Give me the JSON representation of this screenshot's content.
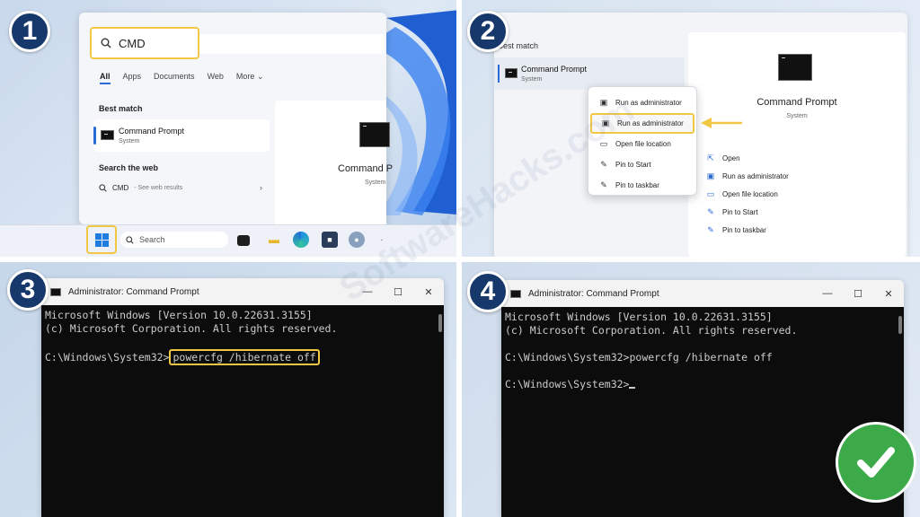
{
  "steps": [
    "1",
    "2",
    "3",
    "4"
  ],
  "step1": {
    "search_value": "CMD",
    "filters": [
      "All",
      "Apps",
      "Documents",
      "Web",
      "More"
    ],
    "more_chevron": "⌄",
    "best_match_label": "Best match",
    "result_name": "Command Prompt",
    "result_sub": "System",
    "search_web_label": "Search the web",
    "web_query": "CMD",
    "web_hint": "- See web results",
    "preview_name": "Command P",
    "preview_sub": "System",
    "taskbar_search": "Search"
  },
  "step2": {
    "best_match_label": "Best match",
    "result_name": "Command Prompt",
    "result_sub": "System",
    "context_menu": [
      "Run as administrator",
      "Run as administrator",
      "Open file location",
      "Pin to Start",
      "Pin to taskbar"
    ],
    "preview_name": "Command Prompt",
    "preview_sub": "System",
    "actions": [
      "Open",
      "Run as administrator",
      "Open file location",
      "Pin to Start",
      "Pin to taskbar"
    ]
  },
  "step3": {
    "window_title": "Administrator: Command Prompt",
    "line1": "Microsoft Windows [Version 10.0.22631.3155]",
    "line2": "(c) Microsoft Corporation. All rights reserved.",
    "prompt": "C:\\Windows\\System32>",
    "command": "powercfg /hibernate off"
  },
  "step4": {
    "window_title": "Administrator: Command Prompt",
    "line1": "Microsoft Windows [Version 10.0.22631.3155]",
    "line2": "(c) Microsoft Corporation. All rights reserved.",
    "line3": "C:\\Windows\\System32>powercfg /hibernate off",
    "prompt": "C:\\Windows\\System32>"
  },
  "window_controls": [
    "—",
    "☐",
    "✕"
  ],
  "watermark": "SoftwareHacks.com",
  "colors": {
    "highlight": "#f2c744",
    "badge": "#17386a",
    "success": "#3daa4a",
    "accent": "#2a6bd6"
  }
}
